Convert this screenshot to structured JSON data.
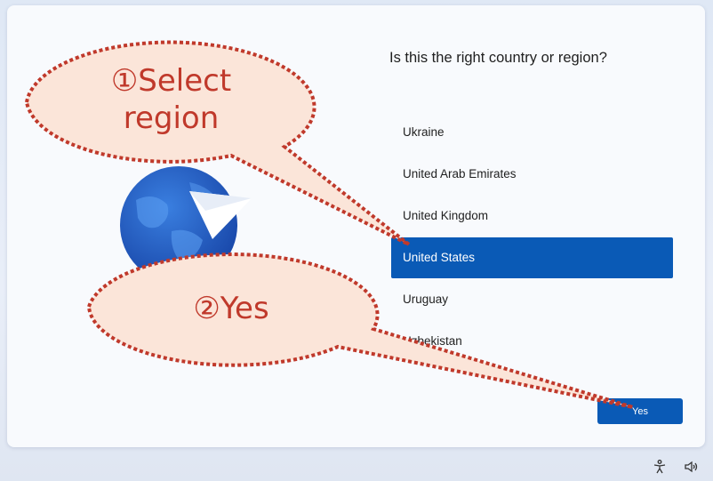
{
  "setup": {
    "question": "Is this the right country or region?",
    "regions": [
      "Ukraine",
      "United Arab Emirates",
      "United Kingdom",
      "United States",
      "Uruguay",
      "Uzbekistan"
    ],
    "selected_index": 3,
    "yes_label": "Yes"
  },
  "annotations": {
    "step1_line1": "①Select",
    "step1_line2": "region",
    "step2": "②Yes",
    "color": "#c0392b",
    "fill": "#fbe5d9"
  },
  "tray": {
    "accessibility_icon": "accessibility-icon",
    "volume_icon": "volume-icon"
  }
}
